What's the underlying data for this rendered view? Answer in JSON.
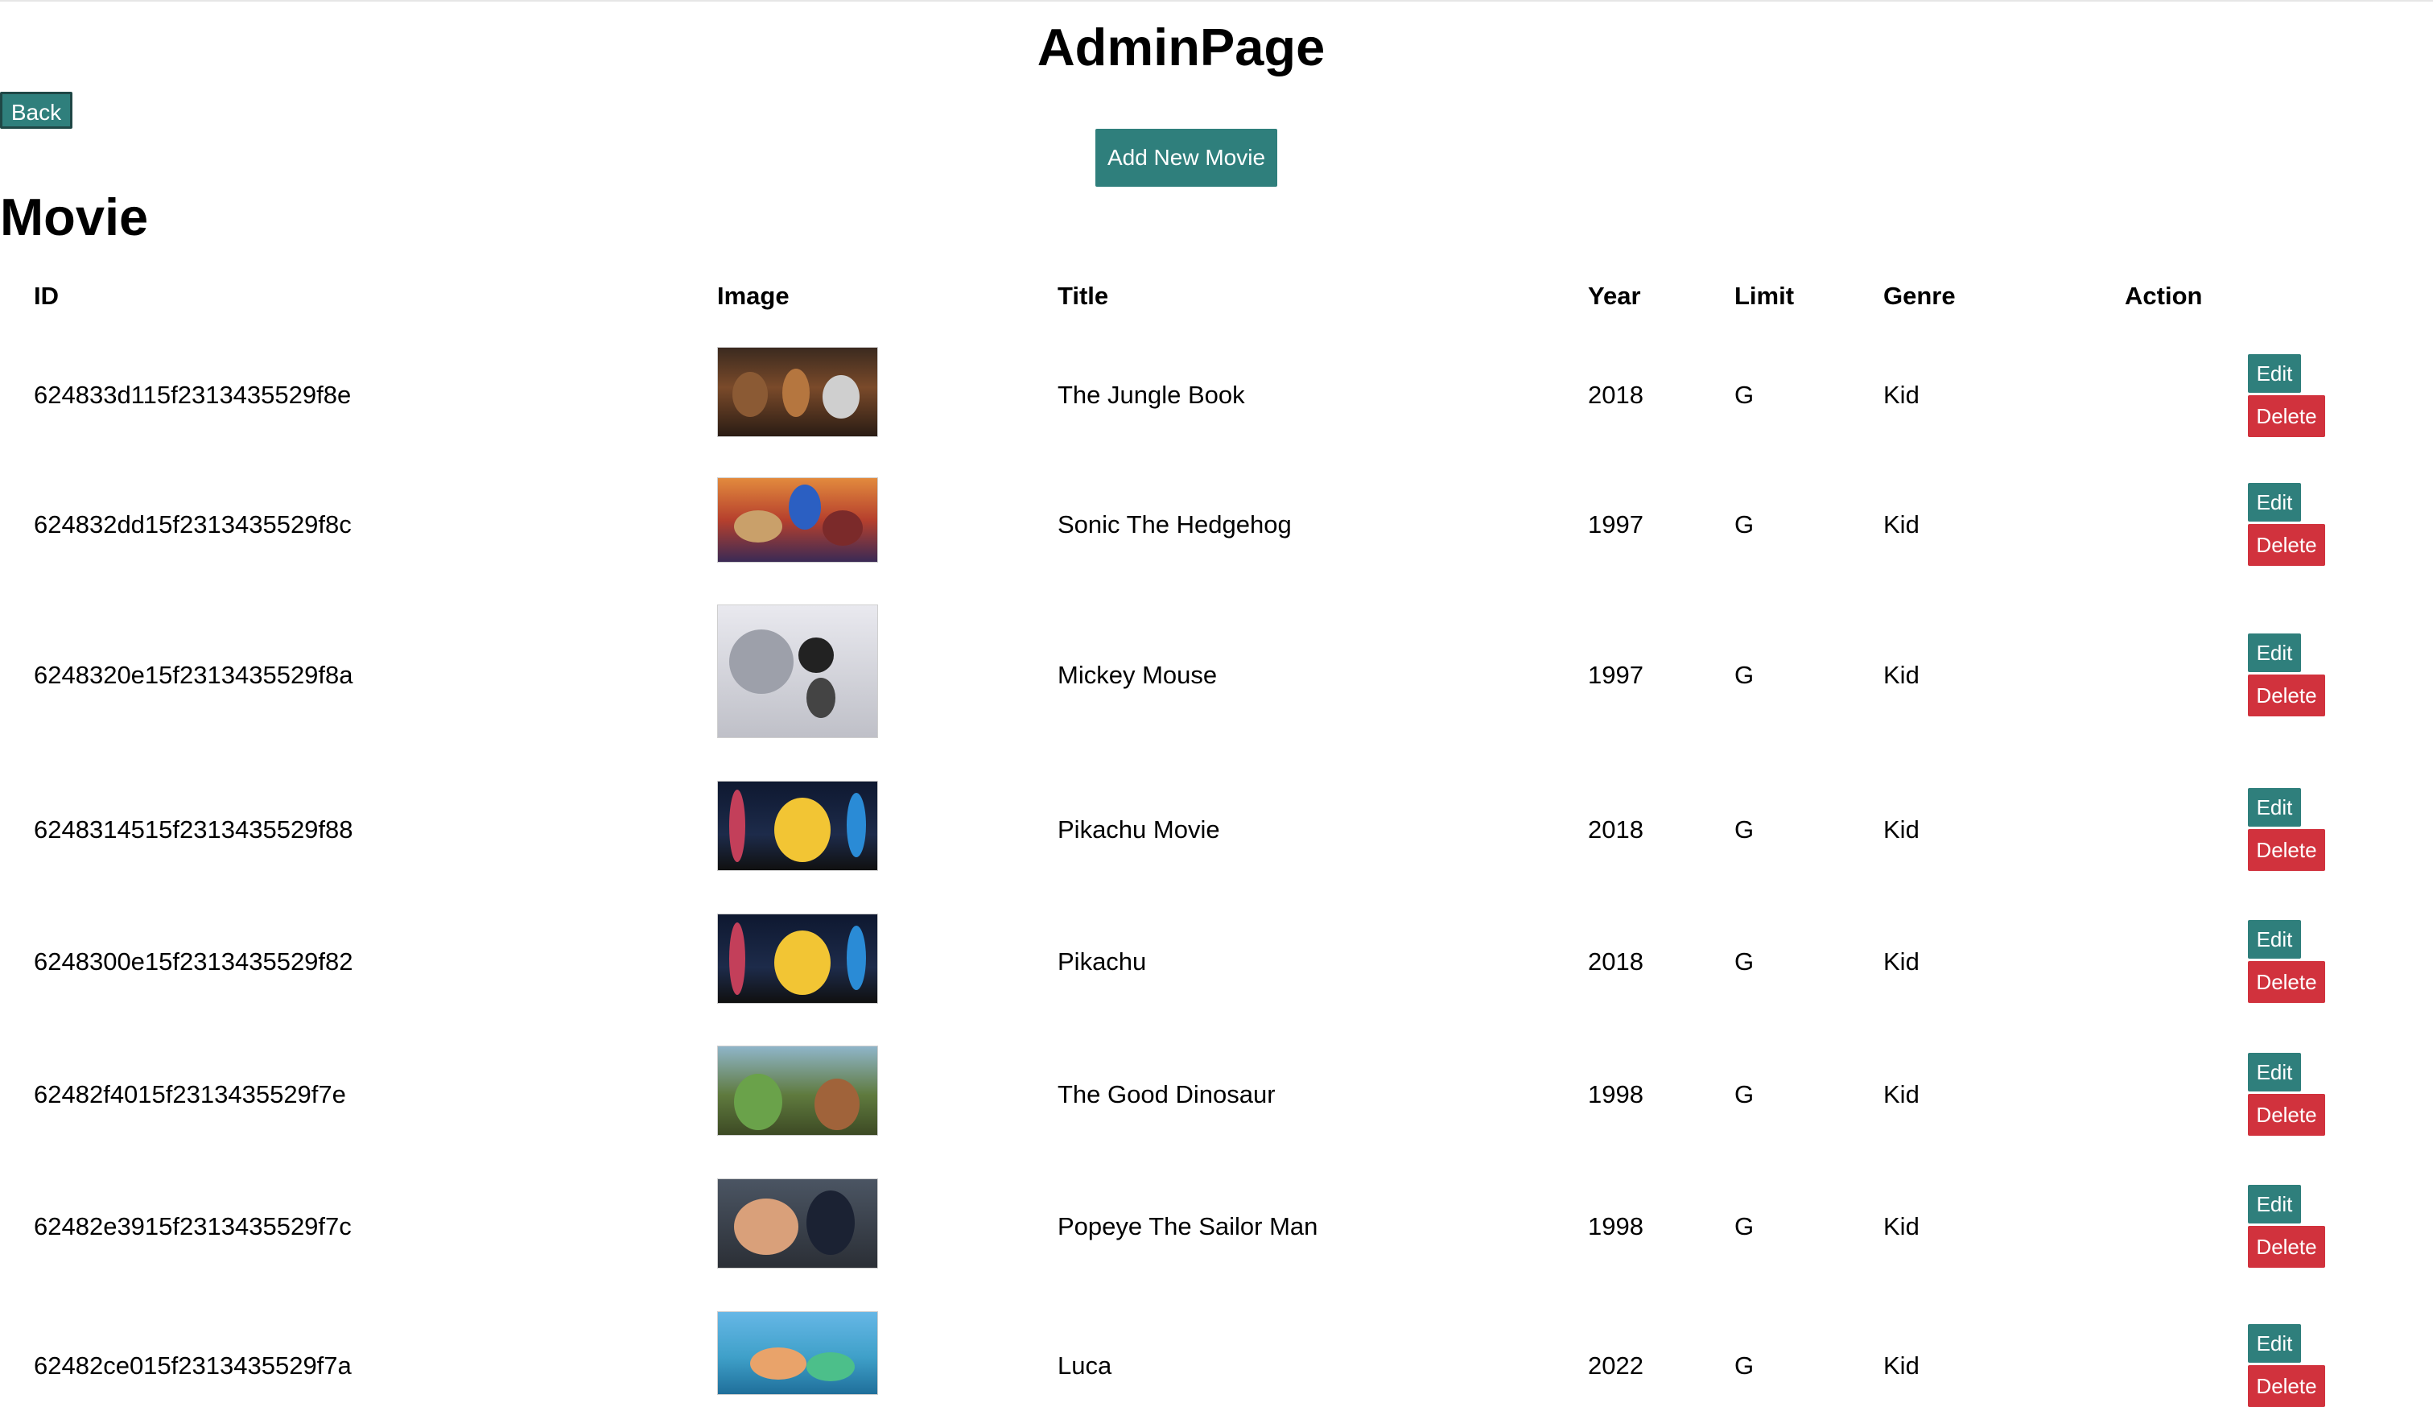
{
  "header": {
    "title": "AdminPage",
    "back_label": "Back",
    "add_label": "Add New Movie"
  },
  "section_title": "Movie",
  "table": {
    "columns": [
      "ID",
      "Image",
      "Title",
      "Year",
      "Limit",
      "Genre",
      "Action"
    ],
    "edit_label": "Edit",
    "delete_label": "Delete",
    "rows": [
      {
        "id": "624833d115f2313435529f8e",
        "title": "The Jungle Book",
        "year": "2018",
        "limit": "G",
        "genre": "Kid",
        "image": "jungle-book-poster"
      },
      {
        "id": "624832dd15f2313435529f8c",
        "title": "Sonic The Hedgehog",
        "year": "1997",
        "limit": "G",
        "genre": "Kid",
        "image": "sonic-poster"
      },
      {
        "id": "6248320e15f2313435529f8a",
        "title": "Mickey Mouse",
        "year": "1997",
        "limit": "G",
        "genre": "Kid",
        "image": "mickey-mouse-poster"
      },
      {
        "id": "6248314515f2313435529f88",
        "title": "Pikachu Movie",
        "year": "2018",
        "limit": "G",
        "genre": "Kid",
        "image": "pikachu-poster"
      },
      {
        "id": "6248300e15f2313435529f82",
        "title": "Pikachu",
        "year": "2018",
        "limit": "G",
        "genre": "Kid",
        "image": "pikachu-poster"
      },
      {
        "id": "62482f4015f2313435529f7e",
        "title": "The Good Dinosaur",
        "year": "1998",
        "limit": "G",
        "genre": "Kid",
        "image": "good-dinosaur-poster"
      },
      {
        "id": "62482e3915f2313435529f7c",
        "title": "Popeye The Sailor Man",
        "year": "1998",
        "limit": "G",
        "genre": "Kid",
        "image": "popeye-poster"
      },
      {
        "id": "62482ce015f2313435529f7a",
        "title": "Luca",
        "year": "2022",
        "limit": "G",
        "genre": "Kid",
        "image": "luca-poster"
      }
    ]
  },
  "colors": {
    "primary": "#2f7f7c",
    "danger": "#d1323d"
  }
}
